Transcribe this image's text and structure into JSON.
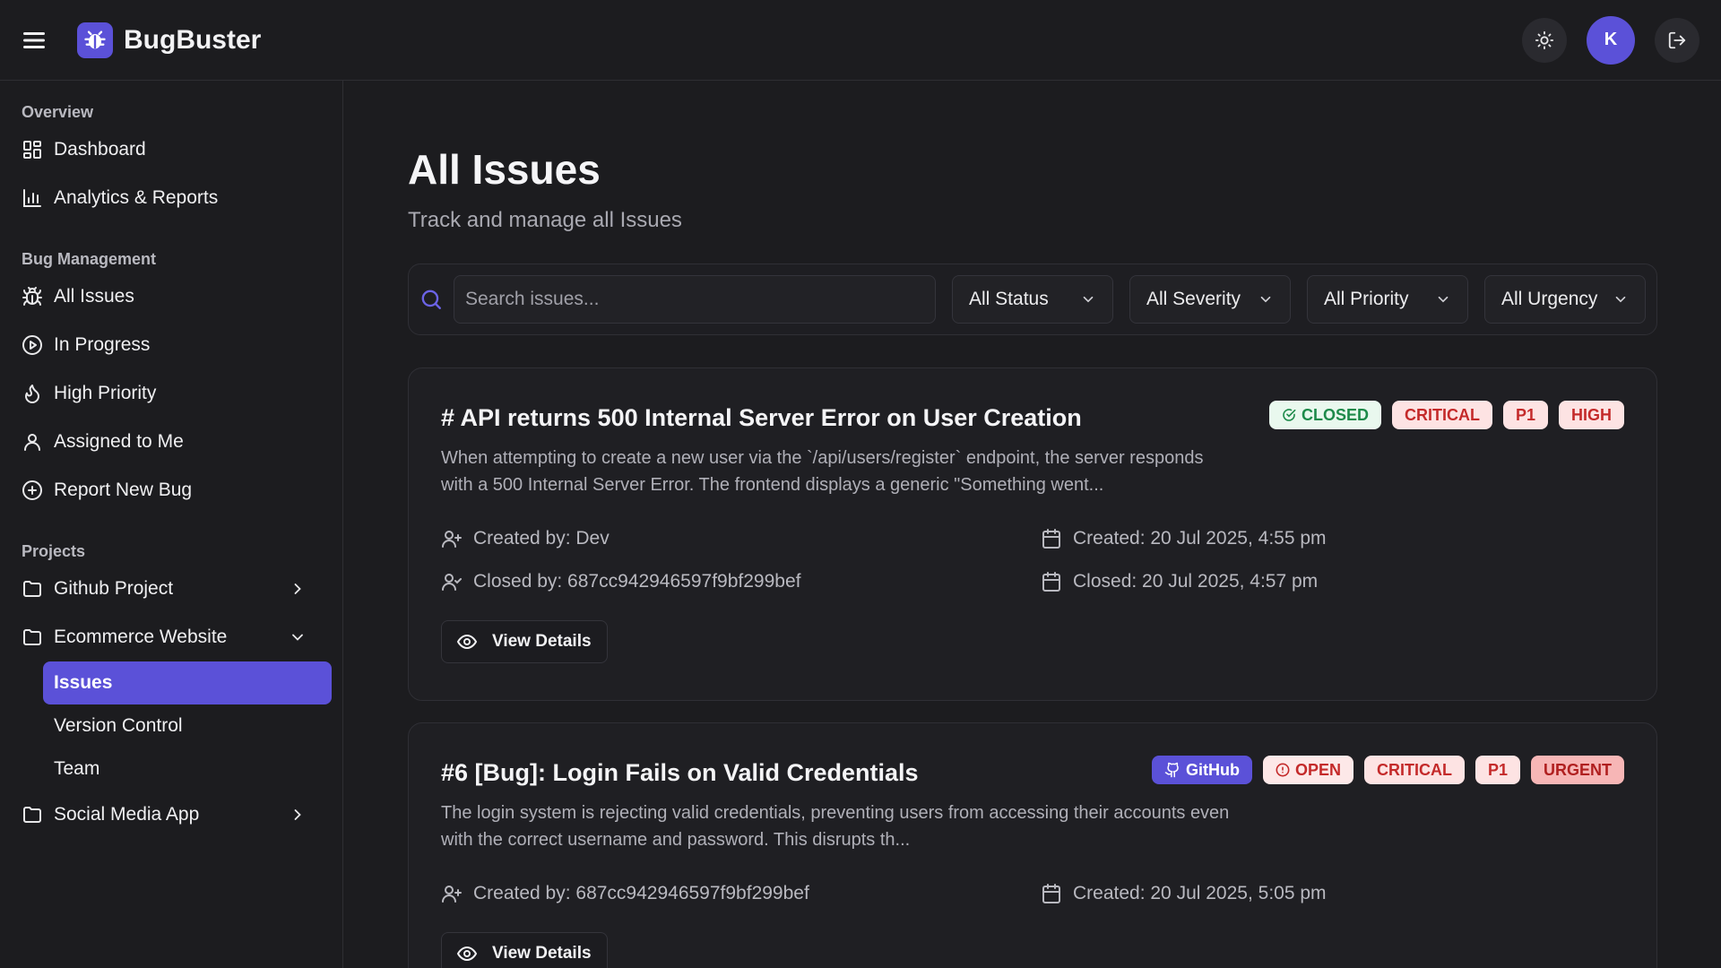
{
  "app": {
    "name": "BugBuster",
    "avatar_initial": "K",
    "accent": "#5b51d8"
  },
  "topbar": {
    "icons": [
      "menu-icon",
      "bug-logo-icon",
      "sun-icon",
      "logout-icon"
    ]
  },
  "sidebar": {
    "overview_label": "Overview",
    "overview_items": [
      {
        "label": "Dashboard",
        "icon": "dashboard-icon"
      },
      {
        "label": "Analytics & Reports",
        "icon": "bar-chart-icon"
      }
    ],
    "bug_mgmt_label": "Bug Management",
    "bug_items": [
      {
        "label": "All Issues",
        "icon": "bug-icon"
      },
      {
        "label": "In Progress",
        "icon": "play-circle-icon"
      },
      {
        "label": "High Priority",
        "icon": "flame-icon"
      },
      {
        "label": "Assigned to Me",
        "icon": "user-icon"
      },
      {
        "label": "Report New Bug",
        "icon": "plus-circle-icon"
      }
    ],
    "projects_label": "Projects",
    "projects": [
      {
        "label": "Github Project",
        "expanded": false
      },
      {
        "label": "Ecommerce Website",
        "expanded": true,
        "children": [
          "Issues",
          "Version Control",
          "Team"
        ],
        "active_child": "Issues"
      },
      {
        "label": "Social Media App",
        "expanded": false
      }
    ]
  },
  "main": {
    "title": "All Issues",
    "subtitle": "Track and manage all Issues",
    "search_placeholder": "Search issues...",
    "filters": [
      "All Status",
      "All Severity",
      "All Priority",
      "All Urgency"
    ]
  },
  "issues": [
    {
      "title": "# API returns 500 Internal Server Error on User Creation",
      "badges": [
        "CLOSED",
        "CRITICAL",
        "P1",
        "HIGH"
      ],
      "description": "When attempting to create a new user via the `/api/users/register` endpoint, the server responds with a 500 Internal Server Error. The frontend displays a generic \"Something went...",
      "created_by": "Created by: Dev",
      "created_at": "Created: 20 Jul 2025, 4:55 pm",
      "closed_by": "Closed by: 687cc942946597f9bf299bef",
      "closed_at": "Closed: 20 Jul 2025, 4:57 pm",
      "view_label": "View Details"
    },
    {
      "title": "#6 [Bug]: Login Fails on Valid Credentials",
      "badges": [
        "GitHub",
        "OPEN",
        "CRITICAL",
        "P1",
        "URGENT"
      ],
      "description": "The login system is rejecting valid credentials, preventing users from accessing their accounts even with the correct username and password. This disrupts th...",
      "created_by": "Created by: 687cc942946597f9bf299bef",
      "created_at": "Created: 20 Jul 2025, 5:05 pm",
      "view_label": "View Details"
    }
  ]
}
